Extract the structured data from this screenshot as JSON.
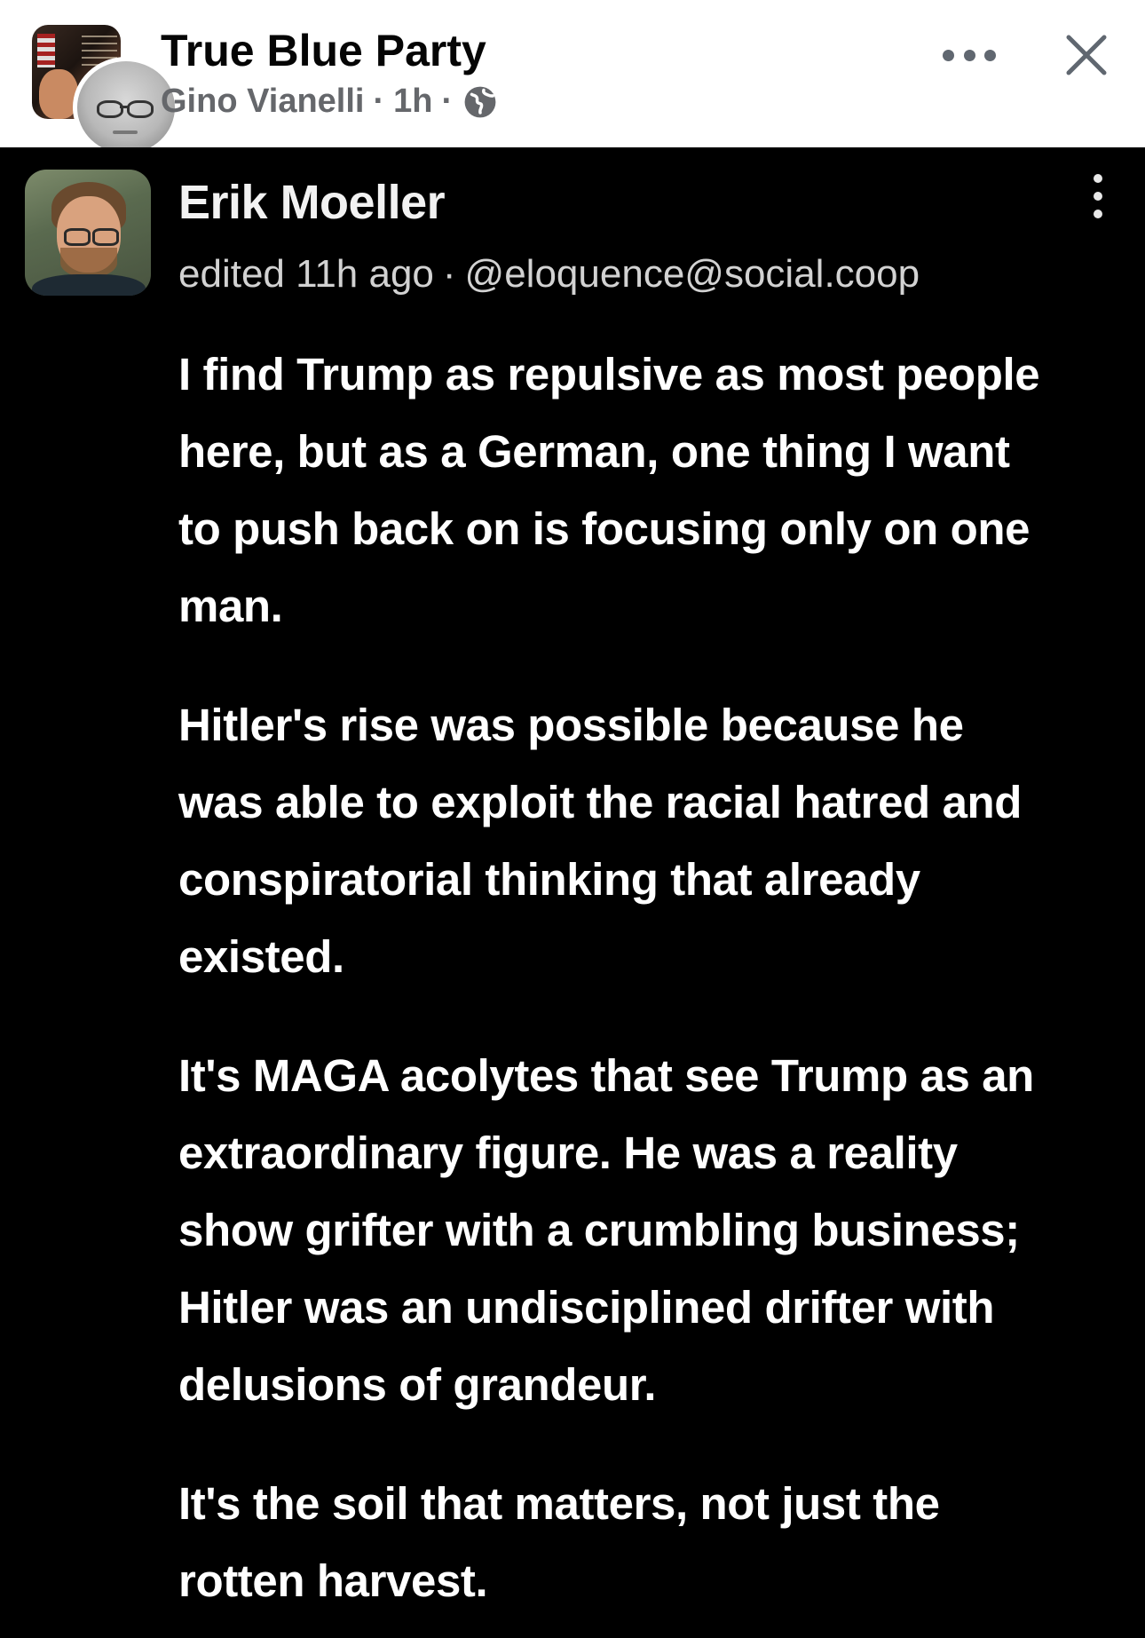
{
  "header": {
    "group_name": "True Blue Party",
    "poster_name": "Gino Vianelli",
    "separator": "·",
    "time": "1h",
    "privacy_icon": "globe-icon",
    "more_icon": "more-horizontal-icon",
    "close_icon": "close-icon"
  },
  "post": {
    "author_name": "Erik Moeller",
    "edited": "edited 11h ago",
    "separator": "·",
    "handle": "@eloquence@social.coop",
    "menu_icon": "more-vertical-icon",
    "paragraphs": [
      {
        "lines": [
          "I find Trump as repulsive as most people",
          "here, but as a German, one thing I want",
          "to push back on is focusing only on one",
          "man."
        ]
      },
      {
        "lines": [
          "Hitler's rise was possible because he",
          "was able to exploit the racial hatred and",
          "conspiratorial thinking that already",
          "existed."
        ]
      },
      {
        "lines": [
          "It's MAGA acolytes that see Trump as an",
          "extraordinary figure. He was a reality",
          "show grifter with a crumbling business;",
          "Hitler was an undisciplined drifter with",
          "delusions of grandeur."
        ]
      },
      {
        "lines": [
          "It's the soil that matters, not just the",
          "rotten harvest."
        ]
      }
    ]
  },
  "colors": {
    "header_bg": "#ffffff",
    "card_bg": "#000000",
    "text_primary_dark": "#050505",
    "text_secondary": "#65676b",
    "card_text": "#ffffff"
  }
}
